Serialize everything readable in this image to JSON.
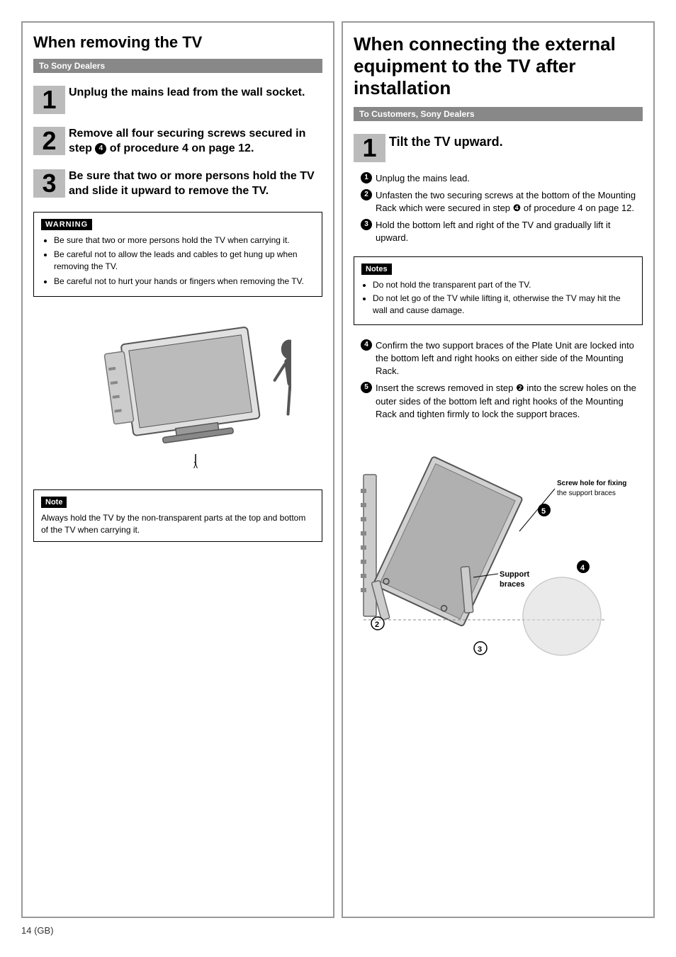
{
  "left": {
    "title": "When removing the TV",
    "dealer_badge": "To Sony Dealers",
    "steps": [
      {
        "num": "1",
        "text": "Unplug the mains lead from the wall socket."
      },
      {
        "num": "2",
        "text": "Remove all four securing screws secured in step ❹ of procedure 4 on page 12."
      },
      {
        "num": "3",
        "text": "Be sure that two or more persons hold the TV and slide it upward to remove the TV."
      }
    ],
    "warning_title": "WARNING",
    "warning_items": [
      "Be sure that two or more persons hold the TV when carrying it.",
      "Be careful not to allow the leads and cables to get hung up when removing the TV.",
      "Be careful not to hurt your hands or fingers when removing the TV."
    ],
    "note_title": "Note",
    "note_text": "Always hold the TV by the non-transparent parts at the top and bottom of the TV when carrying it."
  },
  "right": {
    "title": "When connecting the external equipment to the TV after installation",
    "customer_badge": "To Customers, Sony Dealers",
    "step1_num": "1",
    "step1_text": "Tilt the TV upward.",
    "substeps": [
      {
        "num": "❶",
        "text": "Unplug the mains lead."
      },
      {
        "num": "❷",
        "text": "Unfasten the two securing screws at the bottom of the Mounting Rack which were secured in step ❹ of procedure 4 on page 12."
      },
      {
        "num": "❸",
        "text": "Hold the bottom left and right of the TV and gradually lift it upward."
      }
    ],
    "notes_title": "Notes",
    "notes_items": [
      "Do not hold the transparent part of the TV.",
      "Do not let go of the TV while lifting it, otherwise the TV may hit the wall and cause damage."
    ],
    "substep4": {
      "num": "❹",
      "text": "Confirm the two support braces of the Plate Unit are locked into the bottom left and right hooks on either side of the Mounting Rack."
    },
    "substep5": {
      "num": "❺",
      "text": "Insert the screws removed in step ❷ into the screw holes on the outer sides of the bottom left and right hooks of the Mounting Rack and tighten firmly to lock the support braces."
    },
    "diagram_labels": {
      "screw_hole": "Screw hole for fixing\nthe support braces",
      "support_braces": "Support\nbraces",
      "num5": "❺",
      "num4": "❹",
      "num2": "❷",
      "num3": "❸"
    }
  },
  "footer": {
    "page_num": "14",
    "page_suffix": "(GB)"
  }
}
